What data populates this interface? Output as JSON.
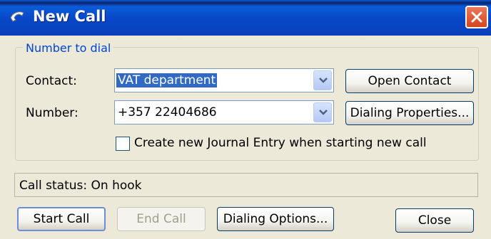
{
  "window": {
    "title": "New Call",
    "icon": "phone-icon",
    "close_icon": "close-icon"
  },
  "group": {
    "label": "Number to dial"
  },
  "contact": {
    "label": "Contact:",
    "value": "VAT department",
    "open_button": "Open Contact"
  },
  "number": {
    "label": "Number:",
    "value": "+357 22404686",
    "dialing_properties_button": "Dialing Properties..."
  },
  "journal": {
    "checkbox_label": "Create new Journal Entry when starting new call",
    "checked": false
  },
  "status": {
    "text": "Call status:  On hook"
  },
  "buttons": {
    "start_call": "Start Call",
    "end_call": "End Call",
    "dialing_options": "Dialing Options...",
    "close": "Close"
  },
  "colors": {
    "titlebar": "#0a4fd0",
    "group_label": "#0046d5",
    "selection": "#316ac5",
    "window_bg": "#ece9d8"
  }
}
